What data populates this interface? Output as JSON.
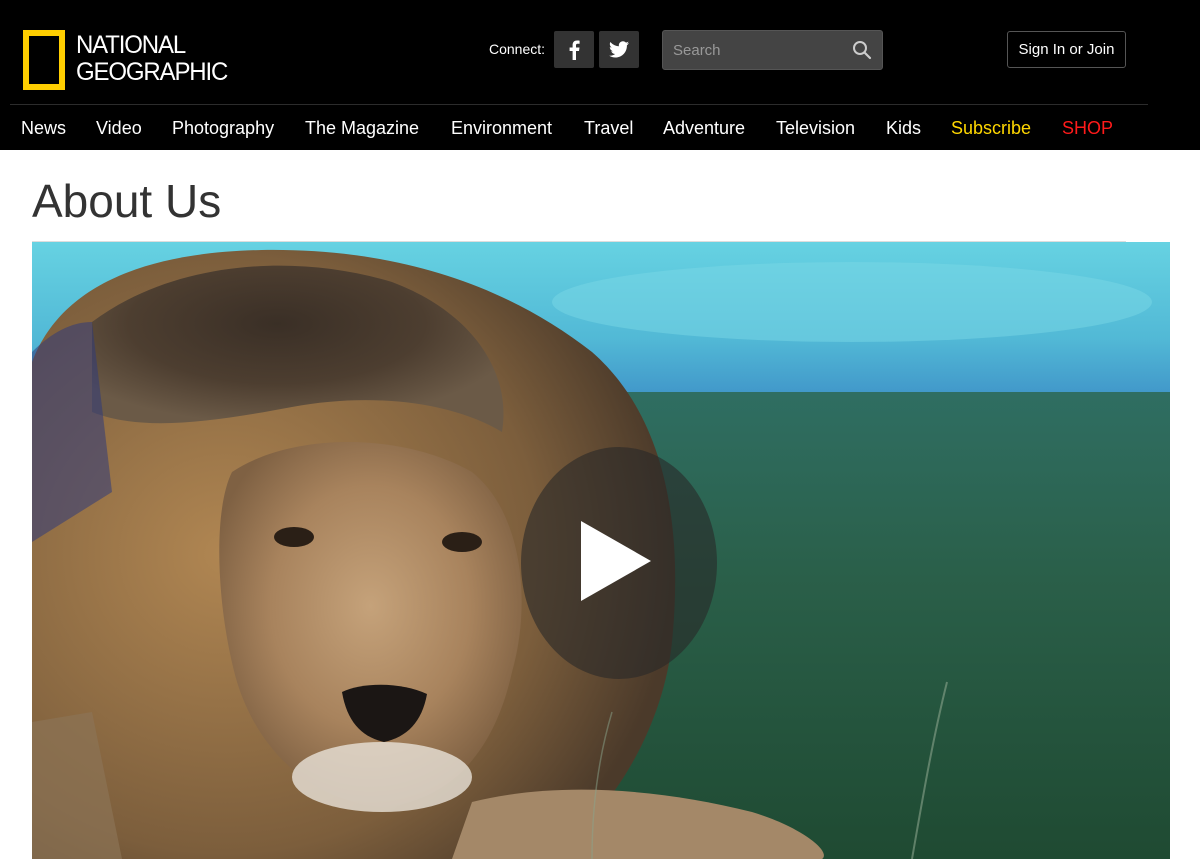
{
  "brand": {
    "line1": "NATIONAL",
    "line2": "GEOGRAPHIC",
    "logo_color": "#ffce00"
  },
  "header": {
    "connect_label": "Connect:",
    "social_icons": [
      "facebook-icon",
      "twitter-icon"
    ],
    "search_placeholder": "Search",
    "signin_label": "Sign In or Join"
  },
  "nav": {
    "items": [
      {
        "label": "News",
        "color": "#ffffff"
      },
      {
        "label": "Video",
        "color": "#ffffff"
      },
      {
        "label": "Photography",
        "color": "#ffffff"
      },
      {
        "label": "The Magazine",
        "color": "#ffffff"
      },
      {
        "label": "Environment",
        "color": "#ffffff"
      },
      {
        "label": "Travel",
        "color": "#ffffff"
      },
      {
        "label": "Adventure",
        "color": "#ffffff"
      },
      {
        "label": "Television",
        "color": "#ffffff"
      },
      {
        "label": "Kids",
        "color": "#ffffff"
      },
      {
        "label": "Subscribe",
        "color": "#ffd700"
      },
      {
        "label": "SHOP",
        "color": "#ff1a1a"
      }
    ]
  },
  "page": {
    "title": "About Us"
  },
  "video": {
    "subject": "lion lying in grass",
    "icon": "play-icon"
  }
}
